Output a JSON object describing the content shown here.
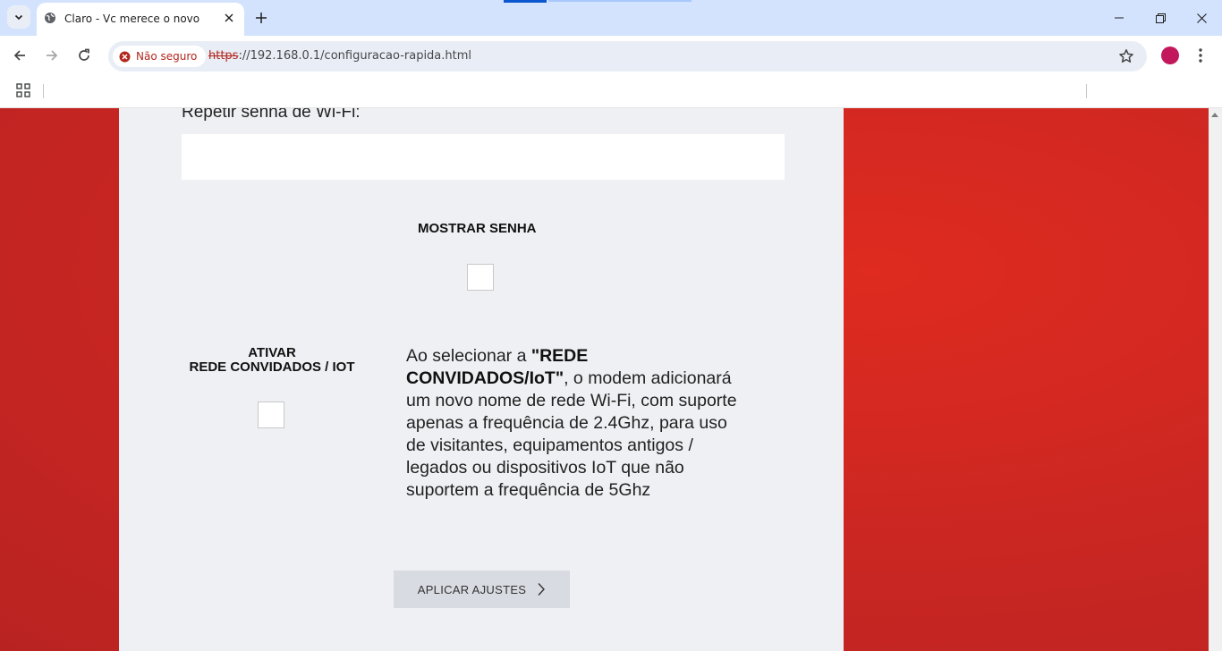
{
  "browser": {
    "tab_title": "Claro - Vc merece o novo",
    "security_chip": "Não seguro",
    "url_scheme": "https",
    "url_rest": "://192.168.0.1/configuracao-rapida.html"
  },
  "form": {
    "repeat_password_label": "Repetir senha de Wi-Fi:",
    "repeat_password_value": "",
    "show_password_label": "MOSTRAR SENHA",
    "show_password_checked": false,
    "guest_network_label_line1": "ATIVAR",
    "guest_network_label_line2": "REDE CONVIDADOS / IOT",
    "guest_network_checked": false,
    "info_prefix": "Ao selecionar a ",
    "info_bold": "\"REDE CONVIDADOS/IoT\"",
    "info_suffix": ", o modem adicionará um novo nome de rede Wi-Fi, com suporte apenas a frequência de 2.4Ghz, para uso de visitantes, equipamentos antigos / legados ou dispositivos IoT que não suportem a frequência de 5Ghz",
    "apply_button_label": "APLICAR AJUSTES"
  },
  "colors": {
    "background_red": "#c92622",
    "panel": "#eff0f4",
    "button": "#d9dbe2"
  },
  "icons": [
    "tab-search-icon",
    "globe-icon",
    "close-icon",
    "plus-icon",
    "minimize-icon",
    "restore-icon",
    "back-arrow-icon",
    "forward-arrow-icon",
    "reload-icon",
    "warning-icon",
    "star-icon",
    "kebab-menu-icon",
    "apps-grid-icon",
    "chevron-right-icon"
  ]
}
